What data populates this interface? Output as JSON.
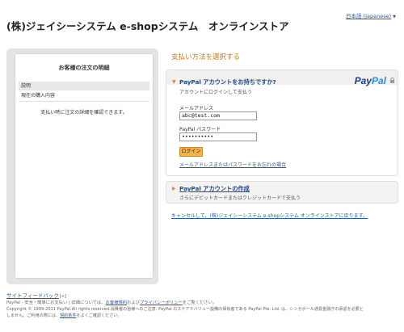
{
  "header": {
    "shop_title": "(株)ジェイシーシステム e-shopシステム　オンラインストア",
    "language": "日本語 (Japanese)"
  },
  "order_summary": {
    "title": "お客様の注文の明細",
    "column_header": "説明",
    "row_label": "現在の購入内容",
    "note": "支払い時に注文の詳細を確認できます。"
  },
  "payment": {
    "section_title": "支払い方法を選択する",
    "login": {
      "title": "PayPal アカウントをお持ちですか?",
      "subtitle": "アカウントにログインして支払う",
      "email_label": "メールアドレス",
      "email_value": "abc@test.com",
      "password_label": "PayPal パスワード",
      "password_value": "••••••••••",
      "login_button": "ログイン",
      "forgot_link": "メールアドレスまたはパスワードをお忘れの場合",
      "logo_pay": "Pay",
      "logo_pal": "Pal"
    },
    "create": {
      "title": "PayPal アカウントの作成",
      "subtitle": "さらにデビットカードまたはクレジットカードで支払う"
    },
    "cancel_link": "キャンセルして、(株)ジェイシーシステム e-shopシステム オンラインストアに戻ります。"
  },
  "footer": {
    "feedback": "サイトフィードバック",
    "feedback_suffix": "[+]",
    "line1_pre": "PayPal - 安全・簡単にお支払い | 詳細については、",
    "line1_link1": "お客様規約",
    "line1_mid": "および",
    "line1_link2": "プライバシーポリシー",
    "line1_post": "をご覧ください。",
    "line2": "Copyright © 1999-2011 PayPal.All rights reserved.消費者の皆様へのご注意: PayPal のステアドバリュー設備の保有者である PayPal Pte. Ltd. は、シンガポール通貨金融庁の承認を必要と",
    "line3_pre": "しません。ご利用の際には、",
    "line3_link": "契約条件",
    "line3_post": "をよくご確認ください。"
  },
  "colors": {
    "accent_orange": "#d07810",
    "link_blue": "#2a5a9a",
    "paypal_dark": "#1f3f7f",
    "paypal_light": "#2e8ed0",
    "button_orange": "#f6b14a"
  }
}
